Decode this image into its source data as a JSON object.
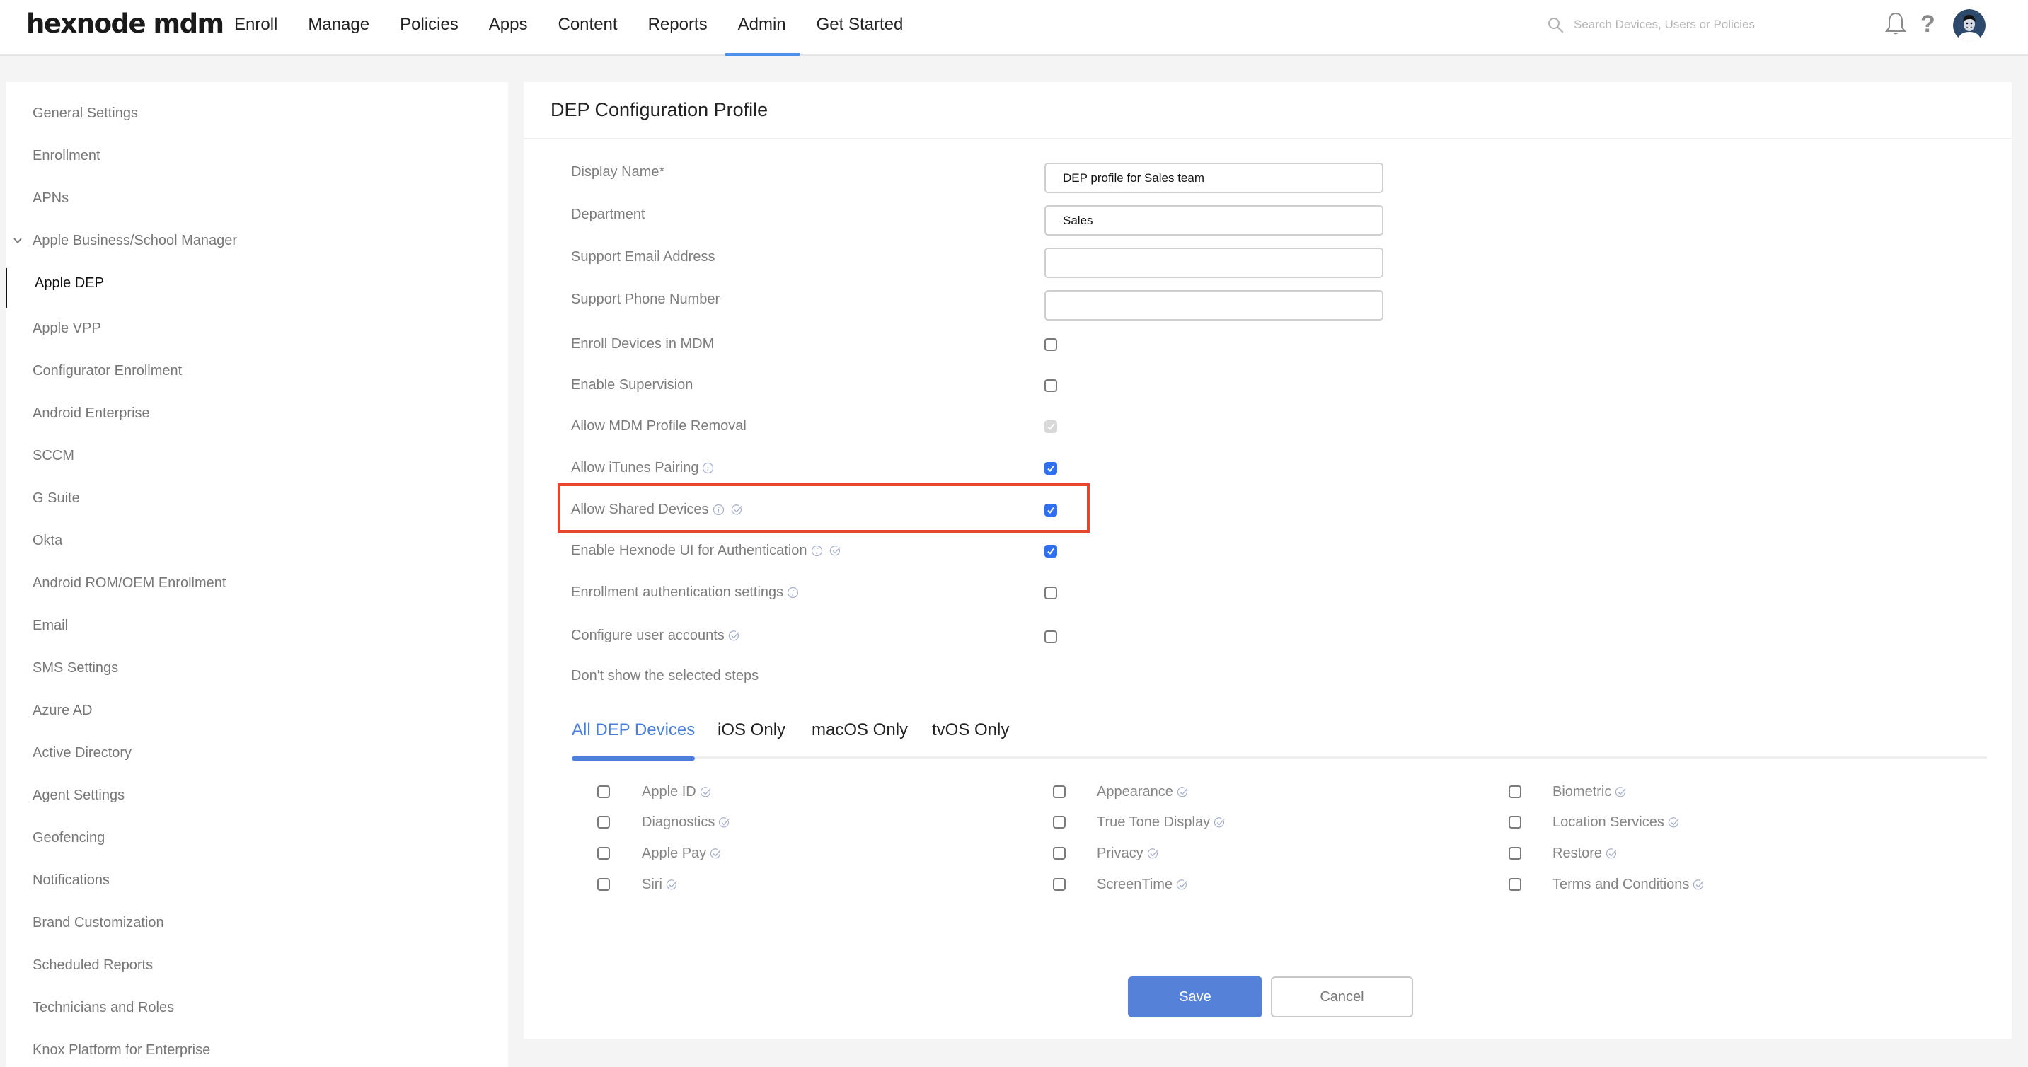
{
  "header": {
    "logo": "hexnode mdm",
    "nav": [
      {
        "label": "Enroll",
        "active": false
      },
      {
        "label": "Manage",
        "active": false
      },
      {
        "label": "Policies",
        "active": false
      },
      {
        "label": "Apps",
        "active": false
      },
      {
        "label": "Content",
        "active": false
      },
      {
        "label": "Reports",
        "active": false
      },
      {
        "label": "Admin",
        "active": true
      },
      {
        "label": "Get Started",
        "active": false
      }
    ],
    "search_placeholder": "Search Devices, Users or Policies",
    "search_value": "",
    "icons": {
      "search": "search-icon",
      "notifications": "bell-icon",
      "help": "?",
      "avatar": "user-avatar"
    },
    "accent_color": "#4a8ef0"
  },
  "sidebar": {
    "items": [
      {
        "label": "General Settings"
      },
      {
        "label": "Enrollment"
      },
      {
        "label": "APNs"
      },
      {
        "label": "Apple Business/School Manager",
        "expanded": true
      },
      {
        "label": "Apple DEP",
        "active": true,
        "child": true
      },
      {
        "label": "Apple VPP"
      },
      {
        "label": "Configurator Enrollment"
      },
      {
        "label": "Android Enterprise"
      },
      {
        "label": "SCCM"
      },
      {
        "label": "G Suite"
      },
      {
        "label": "Okta"
      },
      {
        "label": "Android ROM/OEM Enrollment"
      },
      {
        "label": "Email"
      },
      {
        "label": "SMS Settings"
      },
      {
        "label": "Azure AD"
      },
      {
        "label": "Active Directory"
      },
      {
        "label": "Agent Settings"
      },
      {
        "label": "Geofencing"
      },
      {
        "label": "Notifications"
      },
      {
        "label": "Brand Customization"
      },
      {
        "label": "Scheduled Reports"
      },
      {
        "label": "Technicians and Roles"
      },
      {
        "label": "Knox Platform for Enterprise"
      }
    ]
  },
  "main": {
    "title": "DEP Configuration Profile",
    "fields": [
      {
        "label": "Display Name*",
        "value": "DEP profile for Sales team",
        "placeholder": ""
      },
      {
        "label": "Department",
        "value": "Sales",
        "placeholder": ""
      },
      {
        "label": "Support Email Address",
        "value": "",
        "placeholder": ""
      },
      {
        "label": "Support Phone Number",
        "value": "",
        "placeholder": ""
      }
    ],
    "options": [
      {
        "label": "Enroll Devices in MDM",
        "checked": false,
        "disabled": false,
        "info": false,
        "verified": false
      },
      {
        "label": "Enable Supervision",
        "checked": false,
        "disabled": false,
        "info": false,
        "verified": false
      },
      {
        "label": "Allow MDM Profile Removal",
        "checked": true,
        "disabled": true,
        "info": false,
        "verified": false
      },
      {
        "label": "Allow iTunes Pairing",
        "checked": true,
        "disabled": false,
        "info": true,
        "verified": false
      },
      {
        "label": "Allow Shared Devices",
        "checked": true,
        "disabled": false,
        "info": true,
        "verified": true,
        "highlighted": true
      },
      {
        "label": "Enable Hexnode UI for Authentication",
        "checked": true,
        "disabled": false,
        "info": true,
        "verified": true
      },
      {
        "label": "Enrollment authentication settings",
        "checked": false,
        "disabled": false,
        "info": true,
        "verified": false
      },
      {
        "label": "Configure user accounts",
        "checked": false,
        "disabled": false,
        "info": false,
        "verified": true
      }
    ],
    "skip_steps_label": "Don't show the selected steps",
    "tabs": [
      {
        "label": "All DEP Devices",
        "active": true
      },
      {
        "label": "iOS Only",
        "active": false
      },
      {
        "label": "macOS Only",
        "active": false
      },
      {
        "label": "tvOS Only",
        "active": false
      }
    ],
    "steps": [
      [
        {
          "label": "Apple ID",
          "checked": false
        },
        {
          "label": "Diagnostics",
          "checked": false
        },
        {
          "label": "Apple Pay",
          "checked": false
        },
        {
          "label": "Siri",
          "checked": false
        }
      ],
      [
        {
          "label": "Appearance",
          "checked": false
        },
        {
          "label": "True Tone Display",
          "checked": false
        },
        {
          "label": "Privacy",
          "checked": false
        },
        {
          "label": "ScreenTime",
          "checked": false
        }
      ],
      [
        {
          "label": "Biometric",
          "checked": false
        },
        {
          "label": "Location Services",
          "checked": false
        },
        {
          "label": "Restore",
          "checked": false
        },
        {
          "label": "Terms and Conditions",
          "checked": false
        }
      ]
    ],
    "buttons": {
      "save": "Save",
      "cancel": "Cancel"
    },
    "colors": {
      "primary": "#5681d9",
      "checkbox": "#2f6ff0",
      "highlight": "#e8452f",
      "tab_active": "#4a7fdc"
    }
  }
}
